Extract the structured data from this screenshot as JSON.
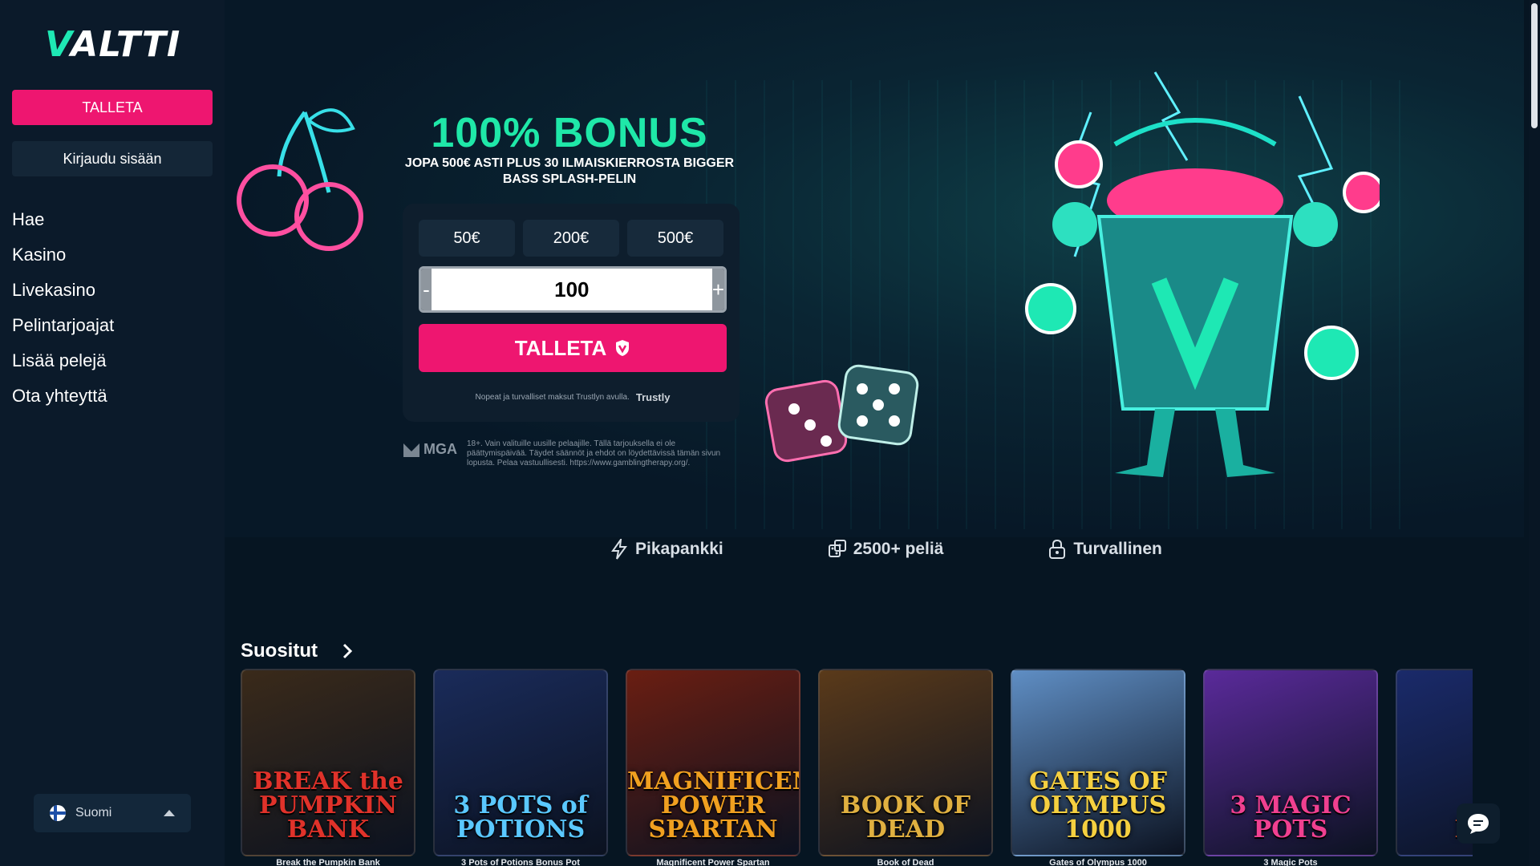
{
  "sidebar": {
    "logo": "VALTTI",
    "deposit_label": "TALLETA",
    "login_label": "Kirjaudu sisään",
    "nav": [
      "Hae",
      "Kasino",
      "Livekasino",
      "Pelintarjoajat",
      "Lisää pelejä",
      "Ota yhteyttä"
    ],
    "language": "Suomi"
  },
  "hero": {
    "headline": "100% BONUS",
    "subline": "JOPA 500€ ASTI PLUS 30 ILMAISKIERROSTA BIGGER BASS SPLASH-PELIN",
    "amounts": [
      "50€",
      "200€",
      "500€"
    ],
    "minus": "-",
    "plus": "+",
    "amount_value": "100",
    "deposit_button": "TALLETA",
    "trustly_note": "Nopeat ja turvalliset maksut Trustlyn avulla.",
    "trustly_brand": "Trustly",
    "mga_logo": "MGA",
    "disclaimer": "18+. Vain valituille uusille pelaajille. Tällä tarjouksella ei ole päättymispäivää. Täydet säännöt ja ehdot on löydettävissä tämän sivun lopusta. Pelaa vastuullisesti. https://www.gamblingtherapy.org/."
  },
  "features": [
    {
      "label": "Pikapankki",
      "icon": "lightning-icon"
    },
    {
      "label": "2500+ peliä",
      "icon": "dice-icon"
    },
    {
      "label": "Turvallinen",
      "icon": "lock-icon"
    }
  ],
  "games_section": {
    "title": "Suositut",
    "games": [
      {
        "name": "Break the Pumpkin Bank",
        "logo": "BREAK the PUMPKIN BANK",
        "bg": "#3a2a1a",
        "accent": "#e0322a"
      },
      {
        "name": "3 Pots of Potions Bonus Pot",
        "logo": "3 POTS of POTIONS",
        "bg": "#1a2b5a",
        "accent": "#5ac8ff"
      },
      {
        "name": "Magnificent Power Spartan",
        "logo": "MAGNIFICENT POWER SPARTAN",
        "bg": "#6a1e12",
        "accent": "#f0a020"
      },
      {
        "name": "Book of Dead",
        "logo": "BOOK OF DEAD",
        "bg": "#5a3a1a",
        "accent": "#e0b040"
      },
      {
        "name": "Gates of Olympus 1000",
        "logo": "GATES OF OLYMPUS 1000",
        "bg": "#5f8ec4",
        "accent": "#f5d040"
      },
      {
        "name": "3 Magic Pots",
        "logo": "3 MAGIC POTS",
        "bg": "#5a2a9a",
        "accent": "#f04090"
      },
      {
        "name": "Re...",
        "logo": "REA",
        "bg": "#1a2a6a",
        "accent": "#e05020"
      }
    ]
  },
  "colors": {
    "accent_pink": "#ee1670",
    "accent_green": "#1fe8a8",
    "background": "#061522"
  }
}
